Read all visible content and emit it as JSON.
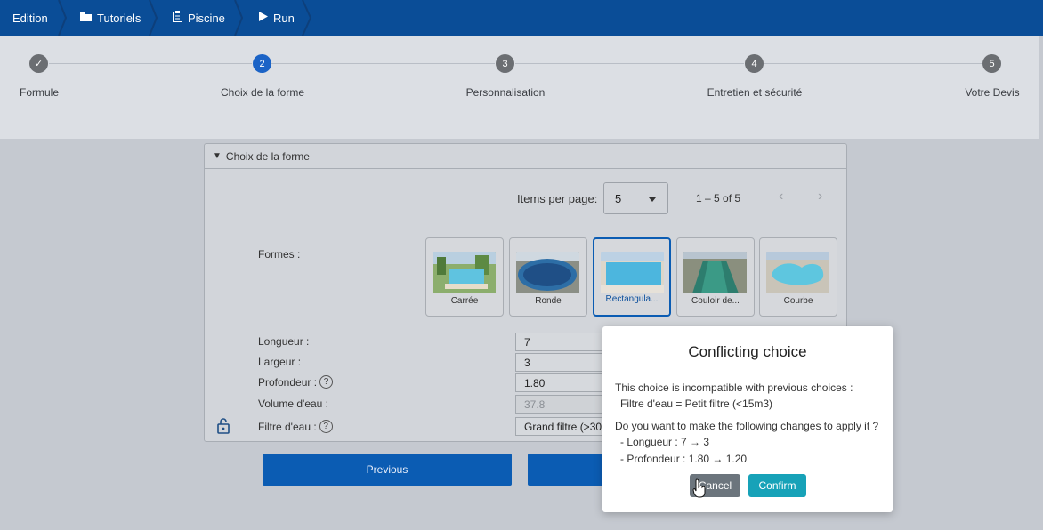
{
  "breadcrumb": [
    {
      "label": "Edition",
      "icon": ""
    },
    {
      "label": "Tutoriels",
      "icon": "folder-icon"
    },
    {
      "label": "Piscine",
      "icon": "clipboard-icon"
    },
    {
      "label": "Run",
      "icon": "play-icon"
    }
  ],
  "stepper": {
    "steps": [
      {
        "number": "✓",
        "label": "Formule",
        "state": "done"
      },
      {
        "number": "2",
        "label": "Choix de la forme",
        "state": "active"
      },
      {
        "number": "3",
        "label": "Personnalisation",
        "state": "pending"
      },
      {
        "number": "4",
        "label": "Entretien et sécurité",
        "state": "pending"
      },
      {
        "number": "5",
        "label": "Votre Devis",
        "state": "pending"
      }
    ]
  },
  "panel": {
    "title": "Choix de la forme",
    "items_per_page_label": "Items per page:",
    "items_per_page_value": "5",
    "range_label": "1 – 5 of 5",
    "formes_label": "Formes :",
    "shapes": [
      {
        "label": "Carrée",
        "selected": false
      },
      {
        "label": "Ronde",
        "selected": false
      },
      {
        "label": "Rectangula...",
        "selected": true
      },
      {
        "label": "Couloir de...",
        "selected": false
      },
      {
        "label": "Courbe",
        "selected": false
      }
    ],
    "fields": {
      "longueur_label": "Longueur :",
      "longueur_value": "7",
      "largeur_label": "Largeur :",
      "largeur_value": "3",
      "profondeur_label": "Profondeur :",
      "profondeur_value": "1.80",
      "volume_label": "Volume d'eau :",
      "volume_value": "37.8",
      "filtre_label": "Filtre d'eau :",
      "filtre_value": "Grand filtre (>30"
    },
    "help_glyph": "?"
  },
  "nav": {
    "previous_label": "Previous"
  },
  "modal": {
    "title": "Conflicting choice",
    "line1": "This choice is incompatible with previous choices :",
    "line2": "Filtre d'eau = Petit filtre (<15m3)",
    "line3": "Do you want to make the following changes to apply it ?",
    "line4": "- Longueur : 7 → 3",
    "line5": "- Profondeur : 1.80 → 1.20",
    "cancel_label": "Cancel",
    "confirm_label": "Confirm"
  },
  "colors": {
    "topbar": "#0a4d97",
    "primary_button": "#0b5cb3",
    "confirm": "#17a2b8",
    "cancel": "#6c757d"
  }
}
